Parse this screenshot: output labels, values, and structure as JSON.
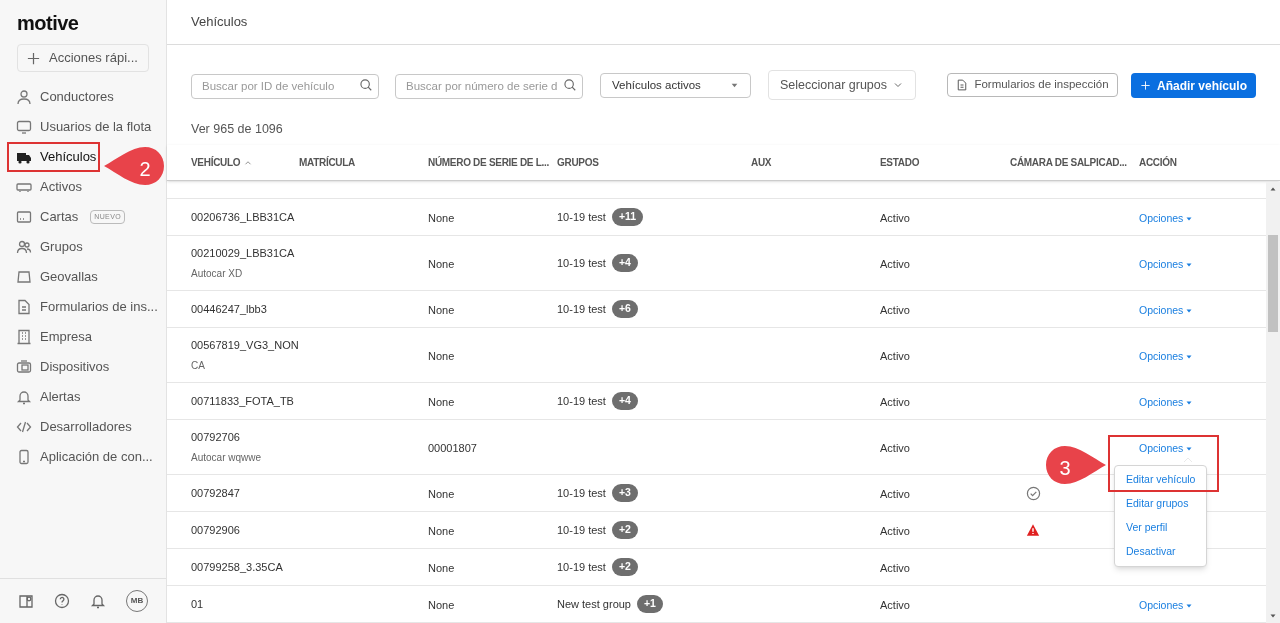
{
  "brand": "motive",
  "quick_action": "Acciones rápi...",
  "nav": [
    {
      "label": "Conductores",
      "selected": false
    },
    {
      "label": "Usuarios de la flota",
      "selected": false
    },
    {
      "label": "Vehículos",
      "selected": true
    },
    {
      "label": "Activos",
      "selected": false
    },
    {
      "label": "Cartas",
      "selected": false,
      "badge": "NUEVO"
    },
    {
      "label": "Grupos",
      "selected": false
    },
    {
      "label": "Geovallas",
      "selected": false
    },
    {
      "label": "Formularios de ins...",
      "selected": false
    },
    {
      "label": "Empresa",
      "selected": false
    },
    {
      "label": "Dispositivos",
      "selected": false
    },
    {
      "label": "Alertas",
      "selected": false
    },
    {
      "label": "Desarrolladores",
      "selected": false
    },
    {
      "label": "Aplicación de con...",
      "selected": false
    }
  ],
  "footer_avatar": "MB",
  "page_title": "Vehículos",
  "filters": {
    "vehicle_search": {
      "placeholder": "Buscar por ID de vehículo"
    },
    "serial_search": {
      "placeholder": "Buscar por número de serie d"
    },
    "status_select": "Vehículos activos",
    "group_select": "Seleccionar grupos",
    "inspection_button": "Formularios de inspección",
    "add_button": "Añadir vehículo"
  },
  "count": "Ver 965 de 1096",
  "table": {
    "columns": [
      "VEHÍCULO",
      "MATRÍCULA",
      "NÚMERO DE SERIE DE L...",
      "GRUPOS",
      "AUX",
      "ESTADO",
      "CÁMARA DE SALPICAD...",
      "ACCIÓN"
    ],
    "rows": [
      {
        "vehicle": "00206736_LBB31CA",
        "serial": "None",
        "group": "10-19 test",
        "extra": "+11",
        "status": "Activo",
        "action": "Opciones"
      },
      {
        "vehicle": "00210029_LBB31CA",
        "subtitle": "Autocar XD",
        "serial": "None",
        "group": "10-19 test",
        "extra": "+4",
        "status": "Activo",
        "action": "Opciones"
      },
      {
        "vehicle": "00446247_lbb3",
        "serial": "None",
        "group": "10-19 test",
        "extra": "+6",
        "status": "Activo",
        "action": "Opciones"
      },
      {
        "vehicle": "00567819_VG3_NON",
        "subtitle": "CA",
        "serial": "None",
        "status": "Activo",
        "action": "Opciones"
      },
      {
        "vehicle": "00711833_FOTA_TB",
        "serial": "None",
        "group": "10-19 test",
        "extra": "+4",
        "status": "Activo",
        "action": "Opciones"
      },
      {
        "vehicle": "00792706",
        "subtitle": "Autocar wqwwe",
        "serial": "00001807",
        "status": "Activo",
        "action": "Opciones"
      },
      {
        "vehicle": "00792847",
        "serial": "None",
        "group": "10-19 test",
        "extra": "+3",
        "status": "Activo",
        "kind": "check"
      },
      {
        "vehicle": "00792906",
        "serial": "None",
        "group": "10-19 test",
        "extra": "+2",
        "status": "Activo",
        "kind": "warning"
      },
      {
        "vehicle": "00799258_3.35CA",
        "serial": "None",
        "group": "10-19 test",
        "extra": "+2",
        "status": "Activo"
      },
      {
        "vehicle": "01",
        "serial": "None",
        "group": "New test group",
        "extra": "+1",
        "status": "Activo",
        "action": "Opciones"
      }
    ]
  },
  "menu": {
    "items": [
      "Editar vehículo",
      "Editar grupos",
      "Ver perfil",
      "Desactivar"
    ]
  },
  "callouts": [
    "2",
    "3"
  ]
}
